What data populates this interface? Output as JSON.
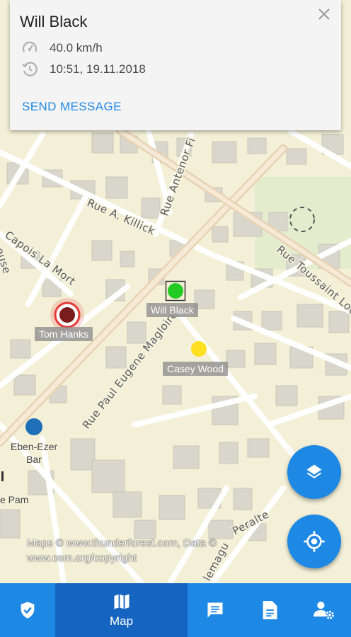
{
  "info_card": {
    "name": "Will Black",
    "speed": "40.0 km/h",
    "datetime": "10:51, 19.11.2018",
    "action": "SEND MESSAGE",
    "speed_icon": "speedometer-icon",
    "time_icon": "clock-history-icon",
    "close_icon": "close-icon"
  },
  "map": {
    "streets": {
      "s1": "Rue A. Killick",
      "s2": "Rue Antenor Fi",
      "s3": "Capois La Mort",
      "s4": "Rue Toussaint Lou",
      "s5": "Rue Paul Eugene Magloire",
      "s6": "euse",
      "s7": "Peralte",
      "s8": "lemagu"
    },
    "markers": [
      {
        "name": "Tom Hanks",
        "color": "#7b1c1c",
        "highlight": "#e53935"
      },
      {
        "name": "Will Black",
        "color": "#22cc22"
      },
      {
        "name": "Casey Wood",
        "color": "#ffdf22"
      },
      {
        "name": "Eben-Ezer Bar",
        "color": "#1e6fb8"
      }
    ],
    "place_labels": {
      "pam": "e Pam"
    },
    "attribution": "Maps © www.thunderforest.com, Data © www.osm.org/copyright"
  },
  "fabs": {
    "layers_icon": "layers-icon",
    "locate_icon": "my-location-icon"
  },
  "nav": {
    "items": [
      {
        "icon": "shield-check-icon",
        "label": ""
      },
      {
        "icon": "map-icon",
        "label": "Map"
      },
      {
        "icon": "chat-icon",
        "label": ""
      },
      {
        "icon": "document-icon",
        "label": ""
      },
      {
        "icon": "user-settings-icon",
        "label": ""
      }
    ],
    "primary_color": "#1e88e5",
    "active_color": "#1565c0"
  }
}
